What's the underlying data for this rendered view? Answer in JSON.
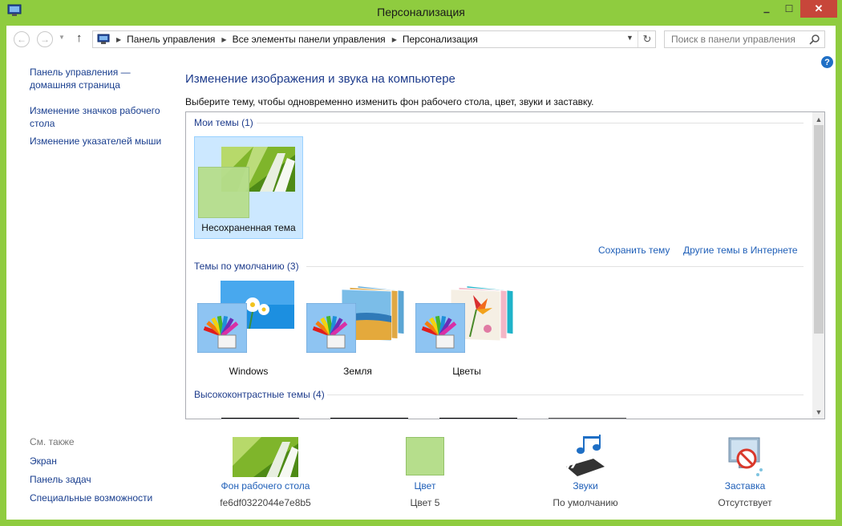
{
  "window": {
    "title": "Персонализация",
    "minimize_label": "▁",
    "maximize_label": "☐",
    "close_label": "✕"
  },
  "navigation": {
    "back_icon": "arrow-left-icon",
    "forward_icon": "arrow-right-icon",
    "up_icon": "arrow-up-icon",
    "breadcrumbs": [
      "Панель управления",
      "Все элементы панели управления",
      "Персонализация"
    ],
    "search_placeholder": "Поиск в панели управления"
  },
  "sidebar": {
    "links": [
      {
        "label": "Панель управления —"
      },
      {
        "label": "домашняя страница"
      },
      {
        "label": "Изменение значков рабочего"
      },
      {
        "label": "стола"
      },
      {
        "label": "Изменение указателей мыши"
      }
    ],
    "see_also_label": "См. также",
    "see_also": [
      {
        "label": "Экран"
      },
      {
        "label": "Панель задач"
      },
      {
        "label": "Специальные возможности"
      }
    ]
  },
  "main": {
    "heading": "Изменение изображения и звука на компьютере",
    "subtext": "Выберите тему, чтобы одновременно изменить фон рабочего стола, цвет, звуки и заставку.",
    "my_themes_title": "Мои темы (1)",
    "unsaved_theme_label": "Несохраненная тема",
    "save_theme_label": "Сохранить тему",
    "more_themes_label": "Другие темы в Интернете",
    "default_themes_title": "Темы по умолчанию (3)",
    "default_themes": [
      {
        "label": "Windows"
      },
      {
        "label": "Земля"
      },
      {
        "label": "Цветы"
      }
    ],
    "high_contrast_title": "Высококонтрастные темы (4)"
  },
  "bottom": [
    {
      "label": "Фон рабочего стола",
      "sub": "fe6df0322044e7e8b5"
    },
    {
      "label": "Цвет",
      "sub": "Цвет 5"
    },
    {
      "label": "Звуки",
      "sub": "По умолчанию"
    },
    {
      "label": "Заставка",
      "sub": "Отсутствует"
    }
  ],
  "colors": {
    "window_frame": "#8fcc3f",
    "accent_swatch": "#b6de8c",
    "link": "#1f5fb8",
    "heading": "#1e3c8c",
    "selected_tile": "#cce8ff"
  }
}
